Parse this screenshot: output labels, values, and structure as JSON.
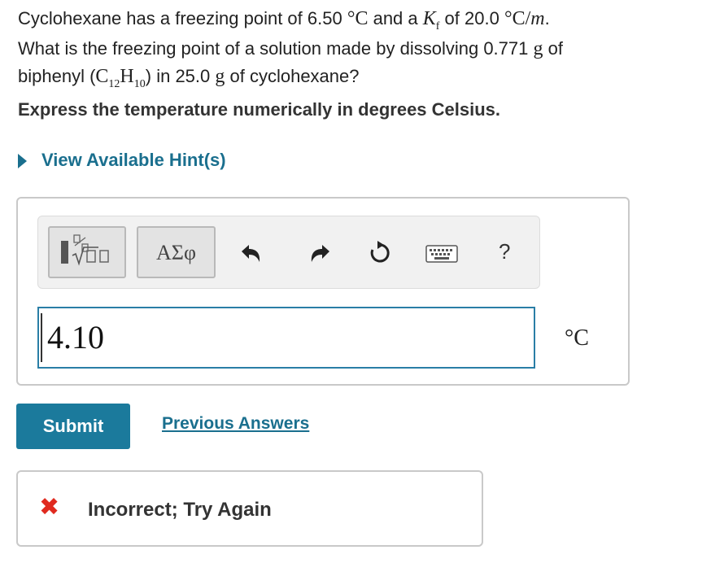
{
  "question": {
    "line1_a": "Cyclohexane has a freezing point of ",
    "line1_fp": "6.50",
    "deg": "°",
    "unit_C": "C",
    "line1_b": " and a ",
    "kf_sym": "K",
    "kf_sub": "f",
    "line1_c": " of ",
    "kf_val": "20.0",
    "unit_Cm": "C/",
    "m_sym": "m",
    "period": ".",
    "line2": "What is the freezing point of a solution made by dissolving ",
    "mass1": "0.771",
    "unit_g": "g",
    "line2_b": " of",
    "line3_a": "biphenyl (",
    "formula_C": "C",
    "formula_C_sub": "12",
    "formula_H": "H",
    "formula_H_sub": "10",
    "line3_b": ") in ",
    "mass2": "25.0",
    "line3_c": " of cyclohexane?"
  },
  "instruction": "Express the temperature numerically in degrees Celsius.",
  "hint_label": "View Available Hint(s)",
  "toolbar": {
    "symbols_label": "ΑΣφ",
    "help_label": "?",
    "icons": [
      "templates-icon",
      "undo-icon",
      "redo-icon",
      "reset-icon",
      "keyboard-icon",
      "help-icon"
    ]
  },
  "answer": {
    "value": "4.10",
    "unit": "°C"
  },
  "submit_label": "Submit",
  "previous_answers_label": "Previous Answers",
  "feedback": {
    "icon": "✖",
    "message": "Incorrect; Try Again"
  },
  "colors": {
    "link": "#1a6f8e",
    "submit_bg": "#1b7a9c",
    "input_border": "#2a7ea6",
    "error": "#e02a1f"
  }
}
